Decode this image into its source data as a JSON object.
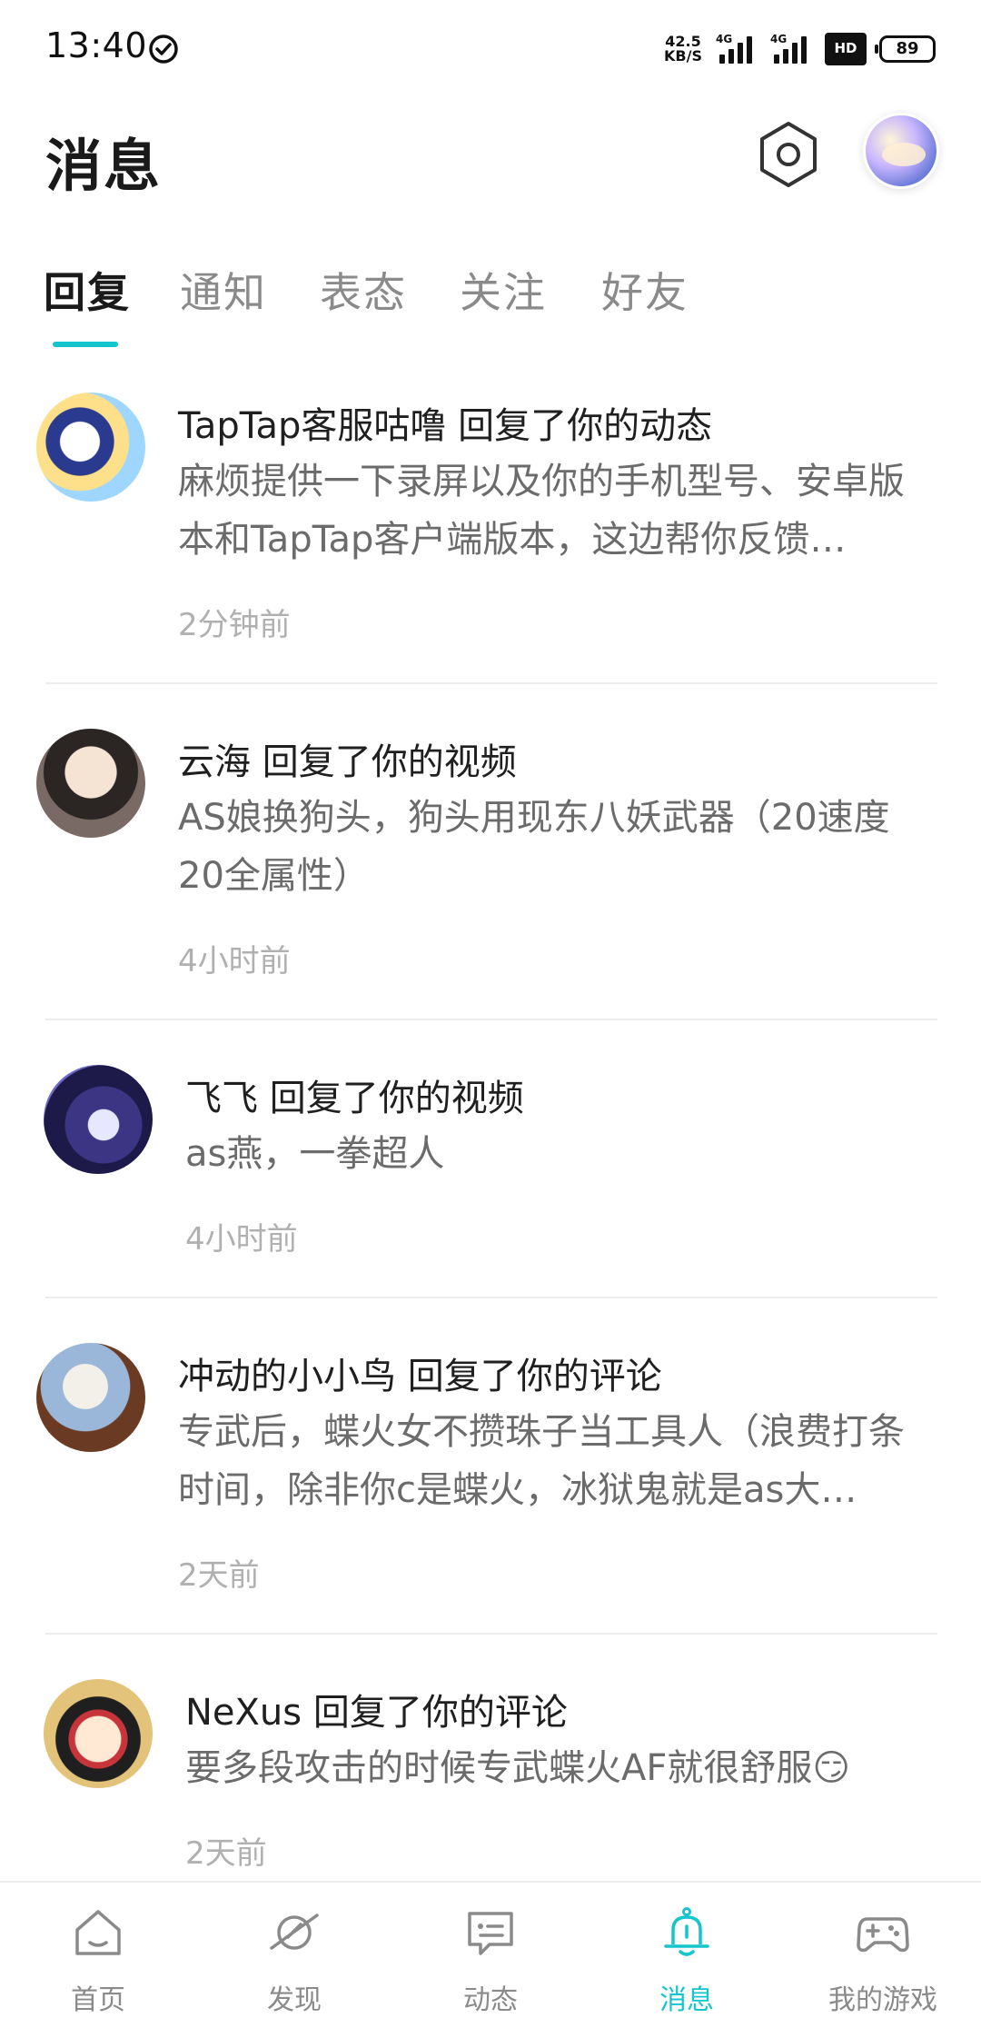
{
  "status_bar": {
    "time": "13:40",
    "net_speed": "42.5 KB/S",
    "net_speed_value": "42.5",
    "net_speed_unit": "KB/S",
    "signal_1_gen": "4G",
    "signal_2_gen": "4G",
    "hd_label": "HD",
    "battery": "89"
  },
  "header": {
    "title": "消息"
  },
  "tabs": [
    {
      "label": "回复",
      "active": true
    },
    {
      "label": "通知",
      "active": false
    },
    {
      "label": "表态",
      "active": false
    },
    {
      "label": "关注",
      "active": false
    },
    {
      "label": "好友",
      "active": false
    }
  ],
  "messages": [
    {
      "title": "TapTap客服咕噜 回复了你的动态",
      "body": "麻烦提供一下录屏以及你的手机型号、安卓版本和TapTap客户端版本，这边帮你反馈…",
      "time": "2分钟前"
    },
    {
      "title": "云海 回复了你的视频",
      "body": "AS娘换狗头，狗头用现东八妖武器（20速度20全属性）",
      "time": "4小时前"
    },
    {
      "title": "飞飞 回复了你的视频",
      "body": "as燕，一拳超人",
      "time": "4小时前"
    },
    {
      "title": "冲动的小小鸟 回复了你的评论",
      "body": "专武后，蝶火女不攒珠子当工具人（浪费打条时间，除非你c是蝶火，冰狱鬼就是as大…",
      "time": "2天前"
    },
    {
      "title": "NeXus 回复了你的评论",
      "body": "要多段攻击的时候专武蝶火AF就很舒服😏",
      "time": "2天前"
    }
  ],
  "bottom_nav": [
    {
      "label": "首页",
      "icon": "home-icon",
      "active": false
    },
    {
      "label": "发现",
      "icon": "planet-icon",
      "active": false
    },
    {
      "label": "动态",
      "icon": "chat-icon",
      "active": false
    },
    {
      "label": "消息",
      "icon": "bell-icon",
      "active": true
    },
    {
      "label": "我的游戏",
      "icon": "gamepad-icon",
      "active": false
    }
  ],
  "colors": {
    "accent": "#15c5ce",
    "text_primary": "#1f1f1f",
    "text_secondary": "#6b6b6b",
    "text_muted": "#b0b0b0"
  }
}
